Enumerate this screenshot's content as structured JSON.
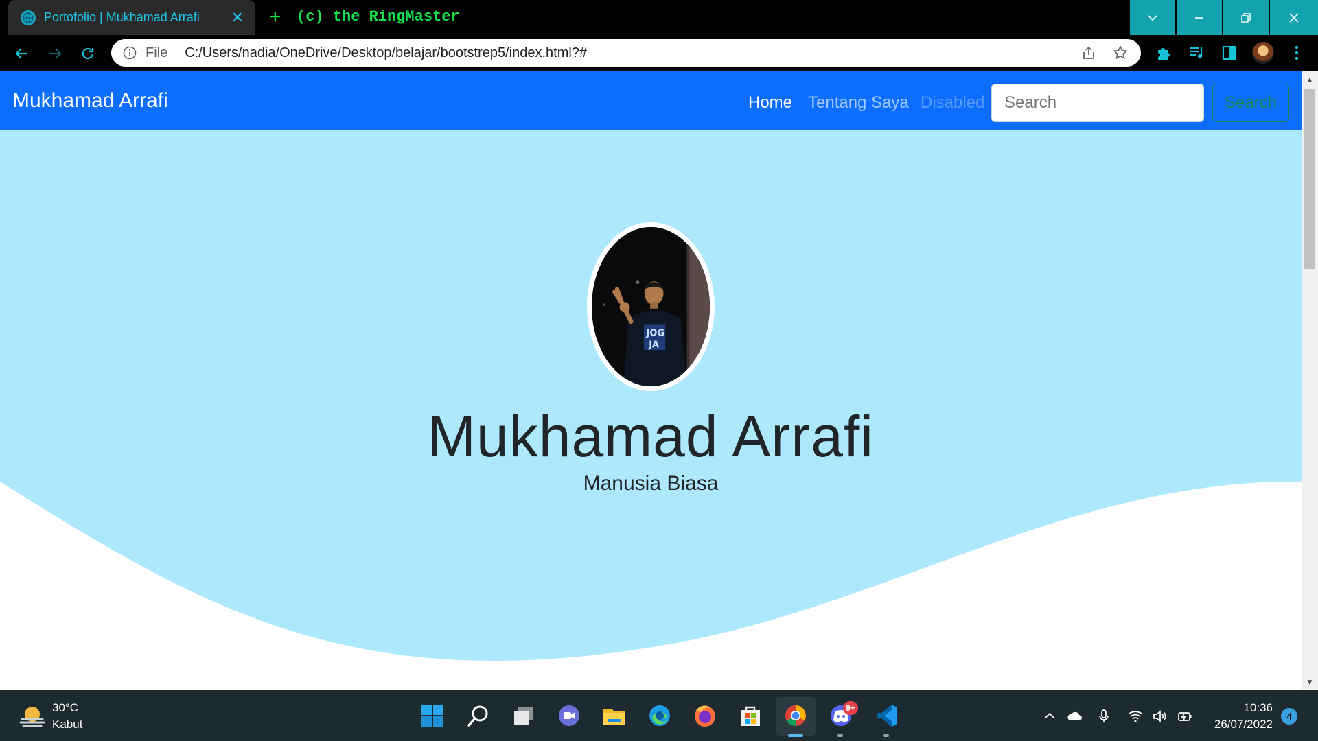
{
  "browser": {
    "tab_title": "Portofolio | Mukhamad Arrafi",
    "tab_close": "✕",
    "new_tab": "+",
    "title_overlay": "(c) the RingMaster",
    "url_protocol": "File",
    "url": "C:/Users/nadia/OneDrive/Desktop/belajar/bootstrep5/index.html?#"
  },
  "navbar": {
    "brand": "Mukhamad Arrafi",
    "links": [
      {
        "label": "Home",
        "state": "active"
      },
      {
        "label": "Tentang Saya",
        "state": "normal"
      },
      {
        "label": "Disabled",
        "state": "disabled"
      }
    ],
    "search_placeholder": "Search",
    "search_button": "Search"
  },
  "hero": {
    "name": "Mukhamad Arrafi",
    "subtitle": "Manusia Biasa",
    "shirt_text": "JOG JA"
  },
  "taskbar": {
    "weather_temp": "30°C",
    "weather_desc": "Kabut",
    "apps": [
      "start-icon",
      "search-icon",
      "task-view-icon",
      "teams-chat-icon",
      "file-explorer-icon",
      "edge-icon",
      "firefox-icon",
      "store-icon",
      "chrome-icon",
      "discord-icon",
      "vscode-icon"
    ],
    "discord_badge": "9+",
    "time": "10:36",
    "date": "26/07/2022",
    "notification_count": "4"
  },
  "colors": {
    "navbar": "#0d6efd",
    "hero_bg": "#aee8fc",
    "tab_text": "#1ec3e8",
    "window_controls": "#12a3ae",
    "terminal_green": "#16e04a",
    "taskbar": "#1d2a30"
  }
}
